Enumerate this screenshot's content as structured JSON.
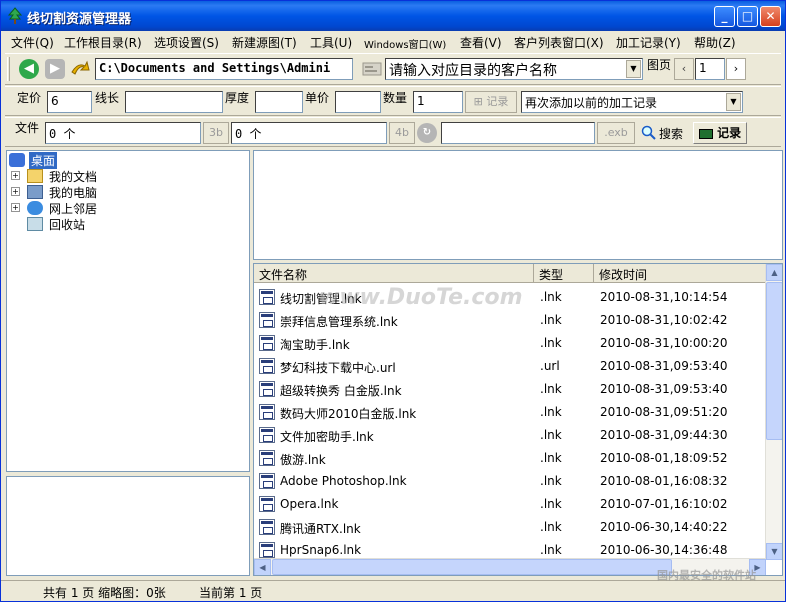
{
  "window": {
    "title": "线切割资源管理器"
  },
  "menu": [
    "文件(Q)",
    "工作根目录(R)",
    "选项设置(S)",
    "新建源图(T)",
    "工具(U)",
    "Windows窗口(W)",
    "查看(V)",
    "客户列表窗口(X)",
    "加工记录(Y)",
    "帮助(Z)"
  ],
  "toolbar1": {
    "path_value": "C:\\Documents and Settings\\Admini",
    "customer_placeholder": "请输入对应目录的客户名称",
    "page_label": "图页",
    "page_value": "1"
  },
  "toolbar2": {
    "price_label": "定价",
    "price_value": "6",
    "length_label": "线长",
    "thickness_label": "厚度",
    "unit_price_label": "单价",
    "qty_label": "数量",
    "qty_value": "1",
    "record_btn_label": "记录",
    "history_select_value": "再次添加以前的加工记录"
  },
  "toolbar3": {
    "file_label": "文件",
    "count_3b": "0  个",
    "btn_3b": "3b",
    "count_4b": "0  个",
    "btn_4b": "4b",
    "btn_exb": ".exb",
    "search_label": "搜索",
    "record_label": "记录"
  },
  "tree": [
    {
      "label": "桌面",
      "level": 0,
      "expander": "",
      "selected": true
    },
    {
      "label": "我的文档",
      "level": 1,
      "expander": "+"
    },
    {
      "label": "我的电脑",
      "level": 1,
      "expander": "+"
    },
    {
      "label": "网上邻居",
      "level": 1,
      "expander": "+"
    },
    {
      "label": "回收站",
      "level": 1,
      "expander": ""
    }
  ],
  "files": {
    "columns": [
      "文件名称",
      "类型",
      "修改时间"
    ],
    "rows": [
      {
        "name": "线切割管理.lnk",
        "type": ".lnk",
        "time": "2010-08-31,10:14:54"
      },
      {
        "name": "崇拜信息管理系统.lnk",
        "type": ".lnk",
        "time": "2010-08-31,10:02:42"
      },
      {
        "name": "淘宝助手.lnk",
        "type": ".lnk",
        "time": "2010-08-31,10:00:20"
      },
      {
        "name": "梦幻科技下载中心.url",
        "type": ".url",
        "time": "2010-08-31,09:53:40"
      },
      {
        "name": "超级转换秀 白金版.lnk",
        "type": ".lnk",
        "time": "2010-08-31,09:53:40"
      },
      {
        "name": "数码大师2010白金版.lnk",
        "type": ".lnk",
        "time": "2010-08-31,09:51:20"
      },
      {
        "name": "文件加密助手.lnk",
        "type": ".lnk",
        "time": "2010-08-31,09:44:30"
      },
      {
        "name": "傲游.lnk",
        "type": ".lnk",
        "time": "2010-08-01,18:09:52"
      },
      {
        "name": "Adobe Photoshop.lnk",
        "type": ".lnk",
        "time": "2010-08-01,16:08:32"
      },
      {
        "name": "Opera.lnk",
        "type": ".lnk",
        "time": "2010-07-01,16:10:02"
      },
      {
        "name": "腾讯通RTX.lnk",
        "type": ".lnk",
        "time": "2010-06-30,14:40:22"
      },
      {
        "name": "HprSnap6.lnk",
        "type": ".lnk",
        "time": "2010-06-30,14:36:48"
      }
    ]
  },
  "status": {
    "total": "共有 1 页 缩略图：0张",
    "current": "当前第 1 页"
  },
  "watermark": {
    "main": "www.DuoTe.com",
    "corner": "国内最安全的软件站"
  },
  "colors": {
    "titlebar": "#0055e5",
    "chrome": "#ece9d8",
    "border": "#7f9db9"
  }
}
